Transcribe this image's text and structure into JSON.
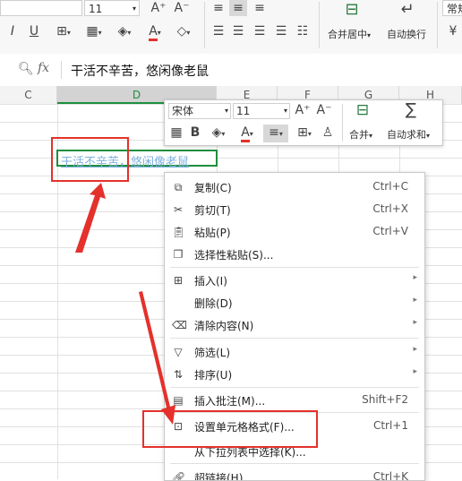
{
  "ribbon": {
    "font_size": "11",
    "font_grow": "A⁺",
    "font_shrink": "A⁻",
    "underline": "U",
    "italic": "I",
    "font_color_letter": "A",
    "merge_label": "合并居中",
    "wrap_label": "自动换行",
    "number_format": "常规"
  },
  "formula_bar": {
    "fx": "fx",
    "content": "干活不辛苦，悠闲像老鼠"
  },
  "columns": [
    "C",
    "D",
    "E",
    "F",
    "G",
    "H"
  ],
  "cell": {
    "text": "干活不辛苦，悠闲像老鼠",
    "color": "#7eb0dc"
  },
  "mini_toolbar": {
    "font_name": "宋体",
    "font_size": "11",
    "grow": "A⁺",
    "shrink": "A⁻",
    "bold": "B",
    "font_color": "A",
    "merge_label": "合并",
    "autosum_label": "自动求和"
  },
  "context_menu": {
    "items": [
      {
        "label": "复制(C)",
        "shortcut": "Ctrl+C"
      },
      {
        "label": "剪切(T)",
        "shortcut": "Ctrl+X"
      },
      {
        "label": "粘贴(P)",
        "shortcut": "Ctrl+V"
      },
      {
        "label": "选择性粘贴(S)...",
        "shortcut": ""
      },
      {
        "label": "插入(I)",
        "shortcut": ""
      },
      {
        "label": "删除(D)",
        "shortcut": ""
      },
      {
        "label": "清除内容(N)",
        "shortcut": ""
      },
      {
        "label": "筛选(L)",
        "shortcut": ""
      },
      {
        "label": "排序(U)",
        "shortcut": ""
      },
      {
        "label": "插入批注(M)...",
        "shortcut": "Shift+F2"
      },
      {
        "label": "设置单元格格式(F)...",
        "shortcut": "Ctrl+1"
      },
      {
        "label": "从下拉列表中选择(K)...",
        "shortcut": ""
      },
      {
        "label": "超链接(H)...",
        "shortcut": "Ctrl+K"
      }
    ]
  },
  "colors": {
    "annotation_red": "#e4312b",
    "selection_green": "#1e8f3e",
    "header_active": "#d3d3d3"
  }
}
